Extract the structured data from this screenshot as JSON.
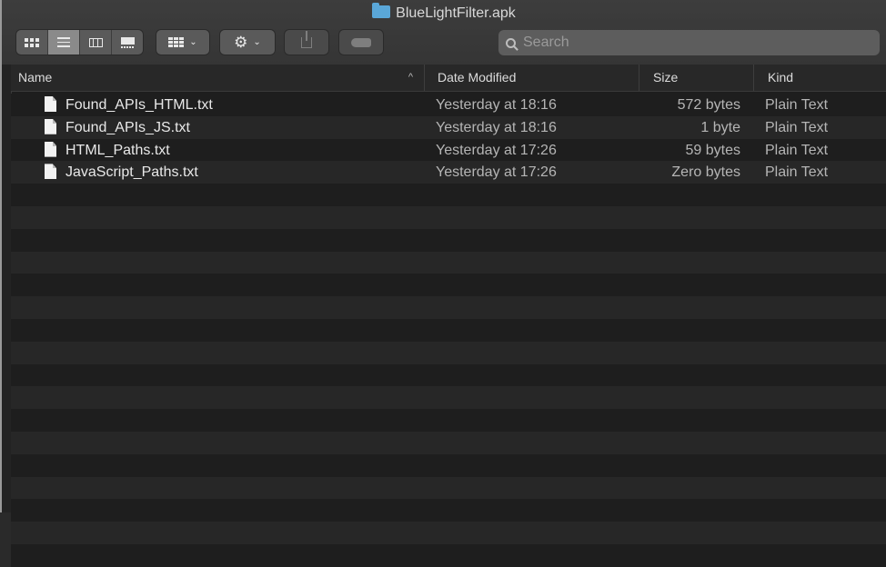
{
  "window": {
    "title": "BlueLightFilter.apk",
    "folder_icon": "folder-icon",
    "accent_color": "#5aa7d8"
  },
  "toolbar": {
    "view_modes": [
      "icon-view",
      "list-view",
      "column-view",
      "gallery-view"
    ],
    "selected_view": "list-view",
    "group_button": "group-by-icon",
    "action_button": "gear-icon",
    "share_button": "share-icon",
    "tag_button": "tag-icon",
    "search_placeholder": "Search"
  },
  "columns": {
    "name": "Name",
    "date": "Date Modified",
    "size": "Size",
    "kind": "Kind",
    "sort_indicator": "^"
  },
  "files": [
    {
      "name": "Found_APIs_HTML.txt",
      "date": "Yesterday at 18:16",
      "size": "572 bytes",
      "kind": "Plain Text"
    },
    {
      "name": "Found_APIs_JS.txt",
      "date": "Yesterday at 18:16",
      "size": "1 byte",
      "kind": "Plain Text"
    },
    {
      "name": "HTML_Paths.txt",
      "date": "Yesterday at 17:26",
      "size": "59 bytes",
      "kind": "Plain Text"
    },
    {
      "name": "JavaScript_Paths.txt",
      "date": "Yesterday at 17:26",
      "size": "Zero bytes",
      "kind": "Plain Text"
    }
  ]
}
